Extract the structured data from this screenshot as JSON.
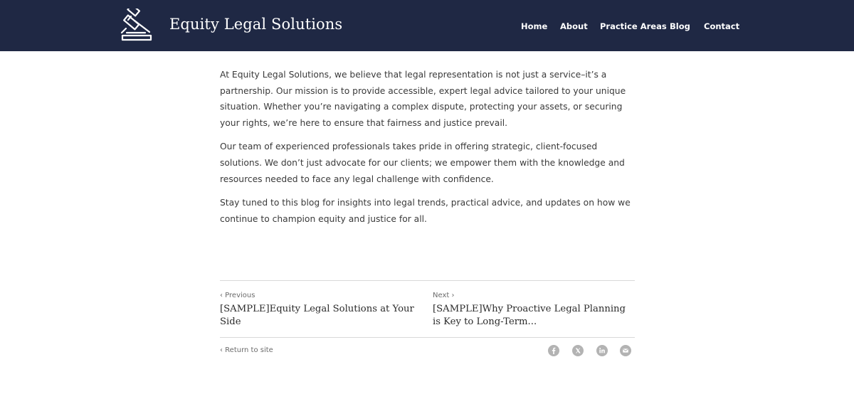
{
  "site": {
    "brand": "Equity Legal Solutions",
    "logo_icon": "gavel-icon"
  },
  "nav": {
    "items": [
      "Home",
      "About",
      "Practice Areas",
      "Blog",
      "Contact"
    ]
  },
  "article": {
    "paragraphs": [
      "At Equity Legal Solutions, we believe that legal representation is not just a service–it’s a partnership. Our mission is to provide accessible, expert legal advice tailored to your unique situation. Whether you’re navigating a complex dispute, protecting your assets, or securing your rights, we’re here to ensure that fairness and justice prevail.",
      "Our team of experienced professionals takes pride in offering strategic, client-focused solutions. We don’t just advocate for our clients; we empower them with the knowledge and resources needed to face any legal challenge with confidence.",
      "Stay tuned to this blog for insights into legal trends, practical advice, and updates on how we continue to champion equity and justice for all."
    ]
  },
  "post_nav": {
    "prev_label": "‹ Previous",
    "prev_title": "[SAMPLE]Equity Legal Solutions at Your Side",
    "next_label": "Next ›",
    "next_title": "[SAMPLE]Why Proactive Legal Planning is Key to Long-Term..."
  },
  "footer": {
    "return_label": "‹ Return to site",
    "share_icons": [
      "facebook-icon",
      "x-icon",
      "linkedin-icon",
      "email-icon"
    ]
  },
  "colors": {
    "header_bg": "#1f2844",
    "share_icon": "#b3b3b3"
  }
}
